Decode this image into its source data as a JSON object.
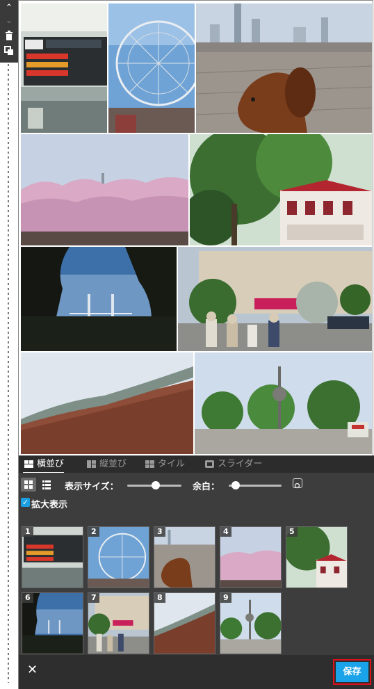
{
  "tabs": [
    {
      "label": "横並び",
      "active": true
    },
    {
      "label": "縦並び",
      "active": false
    },
    {
      "label": "タイル",
      "active": false
    },
    {
      "label": "スライダー",
      "active": false
    }
  ],
  "settings": {
    "size_label": "表示サイズ：",
    "size_value": 0.6,
    "margin_label": "余白：",
    "margin_value": 0.1,
    "zoom_label": "拡大表示",
    "zoom_checked": true
  },
  "thumbnails": [
    {
      "num": "1",
      "subject": "station-sign"
    },
    {
      "num": "2",
      "subject": "ferris-wheel"
    },
    {
      "num": "3",
      "subject": "dog-skyline"
    },
    {
      "num": "4",
      "subject": "cherry-blossoms"
    },
    {
      "num": "5",
      "subject": "building-trees"
    },
    {
      "num": "6",
      "subject": "bridge-silhouette"
    },
    {
      "num": "7",
      "subject": "street-people"
    },
    {
      "num": "8",
      "subject": "wall-sculpture"
    },
    {
      "num": "9",
      "subject": "park-monument"
    }
  ],
  "footer": {
    "close_label": "✕",
    "save_label": "保存"
  },
  "colors": {
    "accent": "#1aa3e8",
    "highlight": "#e0101a"
  }
}
